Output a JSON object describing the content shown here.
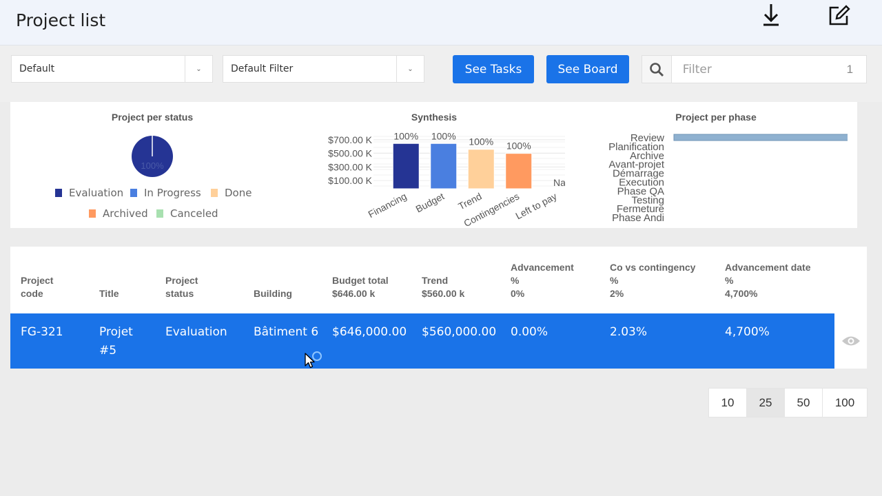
{
  "header": {
    "title": "Project list",
    "download_icon": "download-icon",
    "edit_icon": "edit-icon"
  },
  "toolbar": {
    "view_select": "Default",
    "filter_select": "Default Filter",
    "see_tasks": "See Tasks",
    "see_board": "See Board",
    "search_placeholder": "Filter",
    "search_count": "1"
  },
  "charts": {
    "status": {
      "title": "Project per status",
      "slice_label": "100%",
      "legend": [
        {
          "label": "Evaluation",
          "color": "#253494"
        },
        {
          "label": "In Progress",
          "color": "#4a7fe0"
        },
        {
          "label": "Done",
          "color": "#ffd09a"
        },
        {
          "label": "Archived",
          "color": "#ff9a60"
        },
        {
          "label": "Canceled",
          "color": "#a8e0b0"
        }
      ]
    },
    "synthesis": {
      "title": "Synthesis",
      "y_ticks": [
        "$700.00 K",
        "$500.00 K",
        "$300.00 K",
        "$100.00 K"
      ]
    },
    "phase": {
      "title": "Project per phase",
      "phases": [
        "Review",
        "Planification",
        "Archive",
        "Avant-projet",
        "Démarrage",
        "Execution",
        "Phase QA",
        "Testing",
        "Fermeture",
        "Phase Andi"
      ]
    }
  },
  "chart_data": [
    {
      "type": "pie",
      "title": "Project per status",
      "categories": [
        "Evaluation",
        "In Progress",
        "Done",
        "Archived",
        "Canceled"
      ],
      "values": [
        1,
        0,
        0,
        0,
        0
      ],
      "data_labels": [
        "100%"
      ]
    },
    {
      "type": "bar",
      "title": "Synthesis",
      "categories": [
        "Financing",
        "Budget",
        "Trend",
        "Contingencies",
        "Left to pay"
      ],
      "values": [
        646,
        646,
        560,
        500,
        0
      ],
      "data_labels": [
        "100%",
        "100%",
        "100%",
        "100%",
        "NaN%"
      ],
      "colors": [
        "#253494",
        "#4a7fe0",
        "#ffd09a",
        "#ff9a60",
        "#cccccc"
      ],
      "yticks": [
        "$700.00 K",
        "$500.00 K",
        "$300.00 K",
        "$100.00 K"
      ],
      "ylim": [
        0,
        750
      ]
    },
    {
      "type": "bar",
      "title": "Project per phase",
      "orientation": "horizontal",
      "categories": [
        "Review",
        "Planification",
        "Archive",
        "Avant-projet",
        "Démarrage",
        "Execution",
        "Phase QA",
        "Testing",
        "Fermeture",
        "Phase Andi"
      ],
      "values": [
        1,
        0,
        0,
        0,
        0,
        0,
        0,
        0,
        0,
        0
      ],
      "xlim": [
        0,
        1
      ]
    }
  ],
  "table": {
    "headers": [
      {
        "l1": "Project",
        "l2": "code"
      },
      {
        "l1": "",
        "l2": "Title"
      },
      {
        "l1": "Project",
        "l2": "status"
      },
      {
        "l1": "",
        "l2": "Building"
      },
      {
        "l1": "Budget total",
        "l2": "$646.00 k"
      },
      {
        "l1": "Trend",
        "l2": "$560.00 k"
      },
      {
        "l1": "Advancement",
        "l2": "%",
        "l3": "0%"
      },
      {
        "l1": "Co vs contingency",
        "l2": "%",
        "l3": "2%"
      },
      {
        "l1": "Advancement date",
        "l2": "%",
        "l3": "4,700%"
      }
    ],
    "rows": [
      {
        "code": "FG-321",
        "title": "Projet #5",
        "status": "Evaluation",
        "building": "Bâtiment 6",
        "budget": "$646,000.00",
        "trend": "$560,000.00",
        "advancement": "0.00%",
        "co_contingency": "2.03%",
        "advancement_date": "4,700%"
      }
    ]
  },
  "pagination": {
    "sizes": [
      "10",
      "25",
      "50",
      "100"
    ],
    "active": "25"
  }
}
